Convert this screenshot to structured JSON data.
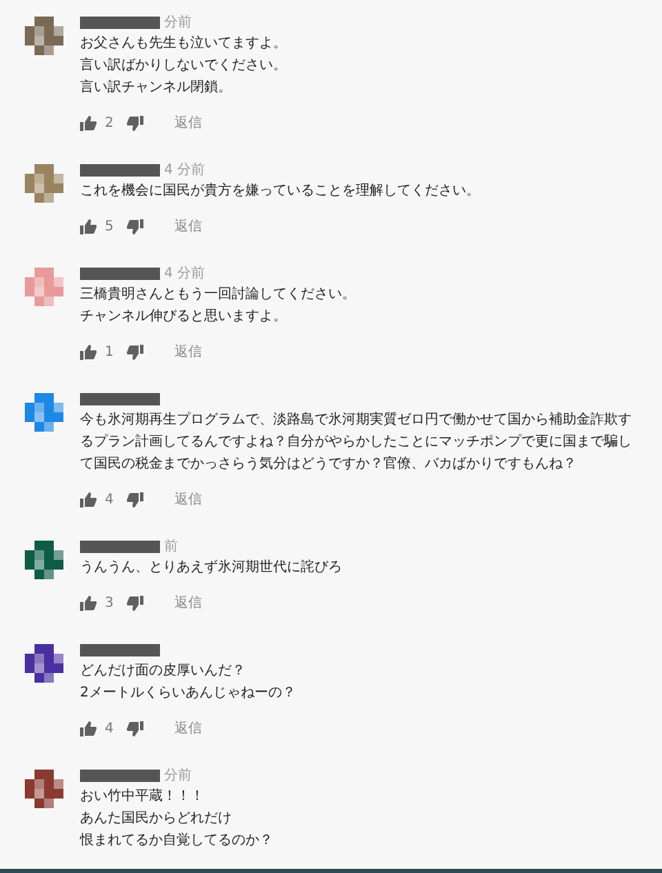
{
  "comments": [
    {
      "color": "#7a6a55",
      "time": "分前",
      "lines": [
        "お父さんも先生も泣いてますよ。",
        "言い訳ばかりしないでください。",
        "言い訳チャンネル閉鎖。"
      ],
      "likes": "2",
      "reply": "返信"
    },
    {
      "color": "#9a8460",
      "time": "4 分前",
      "lines": [
        "これを機会に国民が貴方を嫌っていることを理解してください。"
      ],
      "likes": "5",
      "reply": "返信"
    },
    {
      "color": "#e89a9a",
      "time": "4 分前",
      "lines": [
        "三橋貴明さんともう一回討論してください。",
        "チャンネル伸びると思いますよ。"
      ],
      "likes": "1",
      "reply": "返信"
    },
    {
      "color": "#1e88e5",
      "lines": [
        "今も氷河期再生プログラムで、淡路島で氷河期実質ゼロ円で働かせて国から補助金詐欺するプラン計画してるんですよね？自分がやらかしたことにマッチポンプで更に国まで騙して国民の税金までかっさらう気分はどうですか？官僚、バカばかりですもんね？"
      ],
      "likes": "4",
      "reply": "返信"
    },
    {
      "color": "#0d5c48",
      "time": "前",
      "lines": [
        "うんうん、とりあえず氷河期世代に詫びろ"
      ],
      "likes": "3",
      "reply": "返信"
    },
    {
      "color": "#4a2fa0",
      "lines": [
        "どんだけ面の皮厚いんだ？",
        "2メートルくらいあんじゃねーの？"
      ],
      "likes": "4",
      "reply": "返信"
    },
    {
      "color": "#8a3a30",
      "time": "分前",
      "lines": [
        "おい竹中平蔵！！！",
        "あんた国民からどれだけ",
        "恨まれてるか自覚してるのか？"
      ]
    }
  ]
}
